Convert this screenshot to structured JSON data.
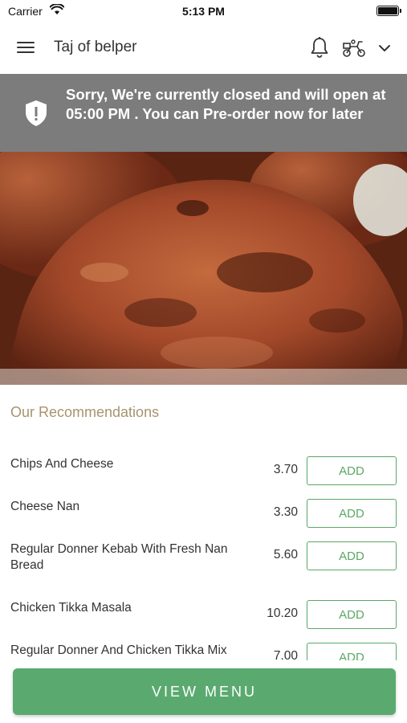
{
  "status_bar": {
    "carrier": "Carrier",
    "time": "5:13 PM"
  },
  "header": {
    "restaurant_name": "Taj of belper",
    "icons": [
      "menu-icon",
      "bell-icon",
      "delivery-scooter-icon",
      "chevron-down-icon"
    ]
  },
  "banner": {
    "message": "Sorry, We're currently closed and will open at 05:00 PM . You can Pre-order now for later",
    "icon": "shield-alert-icon",
    "background": "#7c7c7c"
  },
  "recommendations": {
    "title": "Our Recommendations",
    "items": [
      {
        "name": "Chips And Cheese",
        "price": "3.70",
        "action": "ADD"
      },
      {
        "name": "Cheese Nan",
        "price": "3.30",
        "action": "ADD"
      },
      {
        "name": "Regular Donner Kebab With Fresh Nan Bread",
        "price": "5.60",
        "action": "ADD"
      },
      {
        "name": "Chicken Tikka Masala",
        "price": "10.20",
        "action": "ADD"
      },
      {
        "name": "Regular Donner And Chicken Tikka Mix",
        "price": "7.00",
        "action": "ADD"
      }
    ]
  },
  "footer": {
    "view_menu_label": "VIEW MENU",
    "accent": "#5aaa70"
  }
}
